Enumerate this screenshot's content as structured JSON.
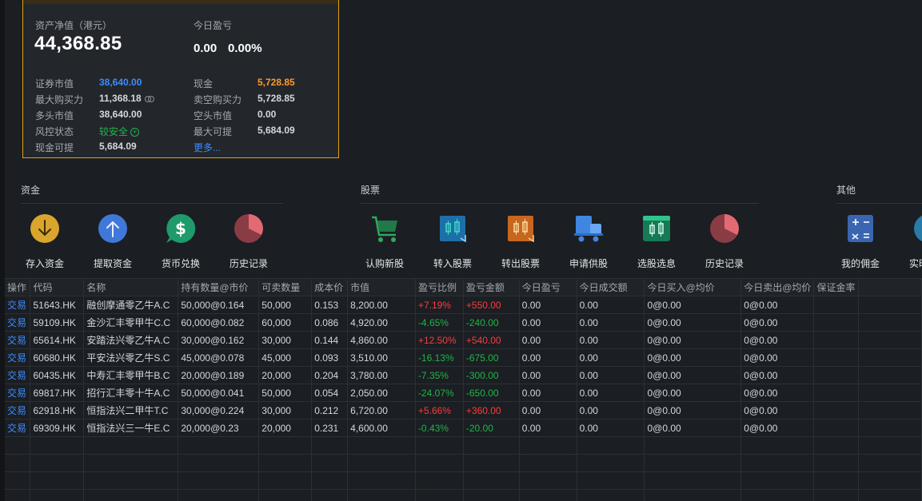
{
  "summary": {
    "net_asset_label": "资产净值（港元）",
    "net_asset_value": "44,368.85",
    "today_pnl_label": "今日盈亏",
    "today_pnl_value": "0.00",
    "today_pnl_pct": "0.00%",
    "left_rows": [
      {
        "label": "证券市值",
        "value": "38,640.00"
      },
      {
        "label": "最大购买力",
        "value": "11,368.18"
      },
      {
        "label": "多头市值",
        "value": "38,640.00"
      },
      {
        "label": "风控状态",
        "value": "较安全"
      },
      {
        "label": "现金可提",
        "value": "5,684.09"
      }
    ],
    "right_rows": [
      {
        "label": "现金",
        "value": "5,728.85"
      },
      {
        "label": "卖空购买力",
        "value": "5,728.85"
      },
      {
        "label": "空头市值",
        "value": "0.00"
      },
      {
        "label": "最大可提",
        "value": "5,684.09"
      }
    ],
    "more_label": "更多..."
  },
  "sections": {
    "funds": {
      "title": "资金",
      "items": [
        {
          "label": "存入资金",
          "icon": "deposit-icon"
        },
        {
          "label": "提取资金",
          "icon": "withdraw-icon"
        },
        {
          "label": "货币兑换",
          "icon": "currency-exchange-icon"
        },
        {
          "label": "历史记录",
          "icon": "history-pie-icon"
        }
      ]
    },
    "stocks": {
      "title": "股票",
      "items": [
        {
          "label": "认购新股",
          "icon": "cart-icon"
        },
        {
          "label": "转入股票",
          "icon": "transfer-in-icon"
        },
        {
          "label": "转出股票",
          "icon": "transfer-out-icon"
        },
        {
          "label": "申请供股",
          "icon": "truck-icon"
        },
        {
          "label": "选股选息",
          "icon": "stock-pick-icon"
        },
        {
          "label": "历史记录",
          "icon": "history-pie-icon"
        }
      ]
    },
    "other": {
      "title": "其他",
      "items": [
        {
          "label": "我的佣金",
          "icon": "calculator-icon"
        },
        {
          "label": "实时",
          "icon": "realtime-icon"
        }
      ]
    }
  },
  "table": {
    "headers": [
      "操作",
      "代码",
      "名称",
      "持有数量@市价",
      "可卖数量",
      "成本价",
      "市值",
      "盈亏比例",
      "盈亏金额",
      "今日盈亏",
      "今日成交额",
      "今日买入@均价",
      "今日卖出@均价",
      "保证金率"
    ],
    "rows": [
      [
        "交易",
        "51643.HK",
        "融创摩通零乙牛A.C",
        "50,000@0.164",
        "50,000",
        "0.153",
        "8,200.00",
        "+7.19%",
        "+550.00",
        "0.00",
        "0.00",
        "0@0.00",
        "0@0.00",
        ""
      ],
      [
        "交易",
        "59109.HK",
        "金沙汇丰零甲牛C.C",
        "60,000@0.082",
        "60,000",
        "0.086",
        "4,920.00",
        "-4.65%",
        "-240.00",
        "0.00",
        "0.00",
        "0@0.00",
        "0@0.00",
        ""
      ],
      [
        "交易",
        "65614.HK",
        "安踏法兴零乙牛A.C",
        "30,000@0.162",
        "30,000",
        "0.144",
        "4,860.00",
        "+12.50%",
        "+540.00",
        "0.00",
        "0.00",
        "0@0.00",
        "0@0.00",
        ""
      ],
      [
        "交易",
        "60680.HK",
        "平安法兴零乙牛S.C",
        "45,000@0.078",
        "45,000",
        "0.093",
        "3,510.00",
        "-16.13%",
        "-675.00",
        "0.00",
        "0.00",
        "0@0.00",
        "0@0.00",
        ""
      ],
      [
        "交易",
        "60435.HK",
        "中寿汇丰零甲牛B.C",
        "20,000@0.189",
        "20,000",
        "0.204",
        "3,780.00",
        "-7.35%",
        "-300.00",
        "0.00",
        "0.00",
        "0@0.00",
        "0@0.00",
        ""
      ],
      [
        "交易",
        "69817.HK",
        "招行汇丰零十牛A.C",
        "50,000@0.041",
        "50,000",
        "0.054",
        "2,050.00",
        "-24.07%",
        "-650.00",
        "0.00",
        "0.00",
        "0@0.00",
        "0@0.00",
        ""
      ],
      [
        "交易",
        "62918.HK",
        "恒指法兴二甲牛T.C",
        "30,000@0.224",
        "30,000",
        "0.212",
        "6,720.00",
        "+5.66%",
        "+360.00",
        "0.00",
        "0.00",
        "0@0.00",
        "0@0.00",
        ""
      ],
      [
        "交易",
        "69309.HK",
        "恒指法兴三一牛E.C",
        "20,000@0.23",
        "20,000",
        "0.231",
        "4,600.00",
        "-0.43%",
        "-20.00",
        "0.00",
        "0.00",
        "0@0.00",
        "0@0.00",
        ""
      ]
    ]
  },
  "colors": {
    "accent_border": "#e0a11a",
    "blue": "#3d8bff",
    "up": "#ff3b3b",
    "down": "#1fb54a",
    "orange": "#ff9a26"
  }
}
